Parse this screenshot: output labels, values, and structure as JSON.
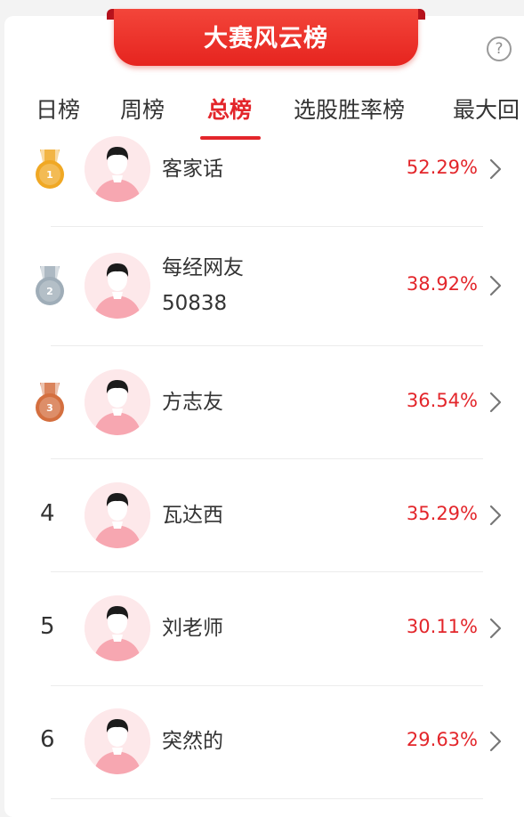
{
  "banner": {
    "title": "大赛风云榜"
  },
  "help": {
    "glyph": "?"
  },
  "tabs": [
    {
      "label": "日榜",
      "active": false
    },
    {
      "label": "周榜",
      "active": false
    },
    {
      "label": "总榜",
      "active": true
    },
    {
      "label": "选股胜率榜",
      "active": false
    },
    {
      "label": "最大回",
      "active": false
    }
  ],
  "colors": {
    "accent": "#e3262b",
    "gold": "#f0a824",
    "silver": "#9fadb8",
    "bronze": "#d46f3f"
  },
  "leaderboard": [
    {
      "rank": "1",
      "medal": "gold",
      "name_line1": "客家话",
      "name_line2": "",
      "rate": "52.29%"
    },
    {
      "rank": "2",
      "medal": "silver",
      "name_line1": "每经网友",
      "name_line2": "50838",
      "rate": "38.92%"
    },
    {
      "rank": "3",
      "medal": "bronze",
      "name_line1": "方志友",
      "name_line2": "",
      "rate": "36.54%"
    },
    {
      "rank": "4",
      "medal": "",
      "name_line1": "瓦达西",
      "name_line2": "",
      "rate": "35.29%"
    },
    {
      "rank": "5",
      "medal": "",
      "name_line1": "刘老师",
      "name_line2": "",
      "rate": "30.11%"
    },
    {
      "rank": "6",
      "medal": "",
      "name_line1": "突然的",
      "name_line2": "",
      "rate": "29.63%"
    }
  ]
}
